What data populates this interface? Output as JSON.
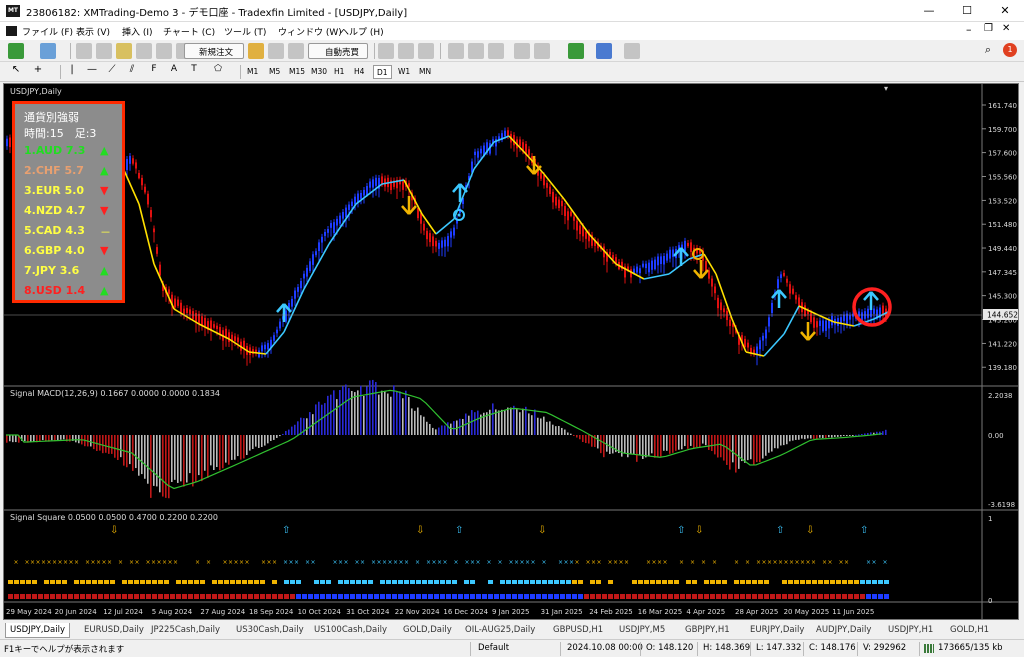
{
  "window": {
    "title": "23806182: XMTrading-Demo 3 - デモ口座 - Tradexfin Limited - [USDJPY,Daily]",
    "icon_text": "MT"
  },
  "menu": [
    "ファイル (F)",
    "表示 (V)",
    "挿入 (I)",
    "チャート (C)",
    "ツール (T)",
    "ウィンドウ (W)",
    "ヘルプ (H)"
  ],
  "toolbar": {
    "new_order_label": "新規注文",
    "auto_trade_label": "自動売買"
  },
  "timeframes": [
    "M1",
    "M5",
    "M15",
    "M30",
    "H1",
    "H4",
    "D1",
    "W1",
    "MN"
  ],
  "active_timeframe": "D1",
  "chart": {
    "symbol_label": "USDJPY,Daily",
    "current_price": "144.652",
    "price_ticks": [
      "161.740",
      "159.700",
      "157.600",
      "155.560",
      "153.520",
      "151.480",
      "149.440",
      "147.345",
      "145.300",
      "143.260",
      "141.220",
      "139.180"
    ],
    "date_ticks": [
      "29 May 2024",
      "20 Jun 2024",
      "12 Jul 2024",
      "5 Aug 2024",
      "27 Aug 2024",
      "18 Sep 2024",
      "10 Oct 2024",
      "31 Oct 2024",
      "22 Nov 2024",
      "16 Dec 2024",
      "9 Jan 2025",
      "31 Jan 2025",
      "24 Feb 2025",
      "16 Mar 2025",
      "4 Apr 2025",
      "28 Apr 2025",
      "20 May 2025",
      "11 Jun 2025"
    ],
    "macd_label": "Signal MACD(12,26,9) 0.1667 0.0000 0.0000 0.1834",
    "macd_ticks": [
      "2.2038",
      "0.00",
      "-3.6198"
    ],
    "square_label": "Signal Square 0.0500 0.0500 0.4700 0.2200 0.2200",
    "square_ticks": [
      "1",
      "0"
    ]
  },
  "strength_panel": {
    "title": "通貨別強弱",
    "subtitle": "時間:15　足:3",
    "rows": [
      {
        "text": "1.AUD 7.3",
        "color": "#22dd22",
        "arrow": "▲",
        "arrow_color": "#22dd22"
      },
      {
        "text": "2.CHF 5.7",
        "color": "#e8a070",
        "arrow": "▲",
        "arrow_color": "#22dd22"
      },
      {
        "text": "3.EUR 5.0",
        "color": "#ffff44",
        "arrow": "▼",
        "arrow_color": "#ff2020"
      },
      {
        "text": "4.NZD 4.7",
        "color": "#ffff44",
        "arrow": "▼",
        "arrow_color": "#ff2020"
      },
      {
        "text": "5.CAD 4.3",
        "color": "#ffff44",
        "arrow": "－",
        "arrow_color": "#ffff44"
      },
      {
        "text": "6.GBP 4.0",
        "color": "#ffff44",
        "arrow": "▼",
        "arrow_color": "#ff2020"
      },
      {
        "text": "7.JPY 3.6",
        "color": "#ffff44",
        "arrow": "▲",
        "arrow_color": "#22dd22"
      },
      {
        "text": "8.USD 1.4",
        "color": "#ff2020",
        "arrow": "▲",
        "arrow_color": "#22dd22"
      }
    ]
  },
  "tabs": [
    "USDJPY,Daily",
    "EURUSD,Daily",
    "JP225Cash,Daily",
    "US30Cash,Daily",
    "US100Cash,Daily",
    "GOLD,Daily",
    "OIL-AUG25,Daily",
    "GBPUSD,H1",
    "USDJPY,M5",
    "GBPJPY,H1",
    "EURJPY,Daily",
    "AUDJPY,Daily",
    "USDJPY,H1",
    "GOLD,H1"
  ],
  "active_tab": "USDJPY,Daily",
  "status": {
    "help": "F1キーでヘルプが表示されます",
    "profile": "Default",
    "datetime": "2024.10.08 00:00",
    "open": "O: 148.120",
    "high": "H: 148.369",
    "low": "L: 147.332",
    "close": "C: 148.176",
    "volume": "V: 292962",
    "traffic": "173665/135 kb"
  },
  "colors": {
    "bull": "#1e3cff",
    "bear": "#e01010",
    "ma_yellow": "#ffe000",
    "ma_cyan": "#3cc8ff",
    "signal_up": "#3cc8ff",
    "signal_down": "#f0b400",
    "highlight": "#ff2020"
  }
}
